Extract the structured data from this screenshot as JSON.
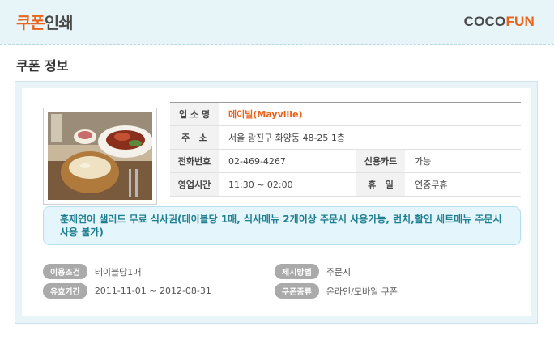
{
  "header": {
    "title_accent": "쿠폰",
    "title_rest": "인쇄",
    "brand_part1": "COCO",
    "brand_part2": "FUN"
  },
  "section": {
    "title": "쿠폰 정보"
  },
  "store": {
    "name_label": "업 소 명",
    "name": "메이빌(Mayville)",
    "address_label": "주   소",
    "address": "서울 광진구 화양동 48-25 1층",
    "phone_label": "전화번호",
    "phone": "02-469-4267",
    "card_label": "신용카드",
    "card": "가능",
    "hours_label": "영업시간",
    "hours": "11:30 ~ 02:00",
    "holiday_label": "휴   일",
    "holiday": "연중무휴"
  },
  "notice": {
    "text": "훈제연어 샐러드 무료 식사권(테이블당 1매, 식사메뉴 2개이상 주문시 사용가능, 런치,할인 세트메뉴 주문시 사용 불가)"
  },
  "meta": {
    "condition_label": "이용조건",
    "condition": "테이블당1매",
    "method_label": "제시방법",
    "method": "주문시",
    "period_label": "유효기간",
    "period": "2011-11-01 ~ 2012-08-31",
    "type_label": "쿠폰종류",
    "type": "온라인/모바일 쿠폰"
  },
  "colors": {
    "accent": "#e8641c",
    "header_bg": "#e7f4f8",
    "notice_text": "#1f7e8f",
    "pill_bg": "#aaaaaa"
  }
}
